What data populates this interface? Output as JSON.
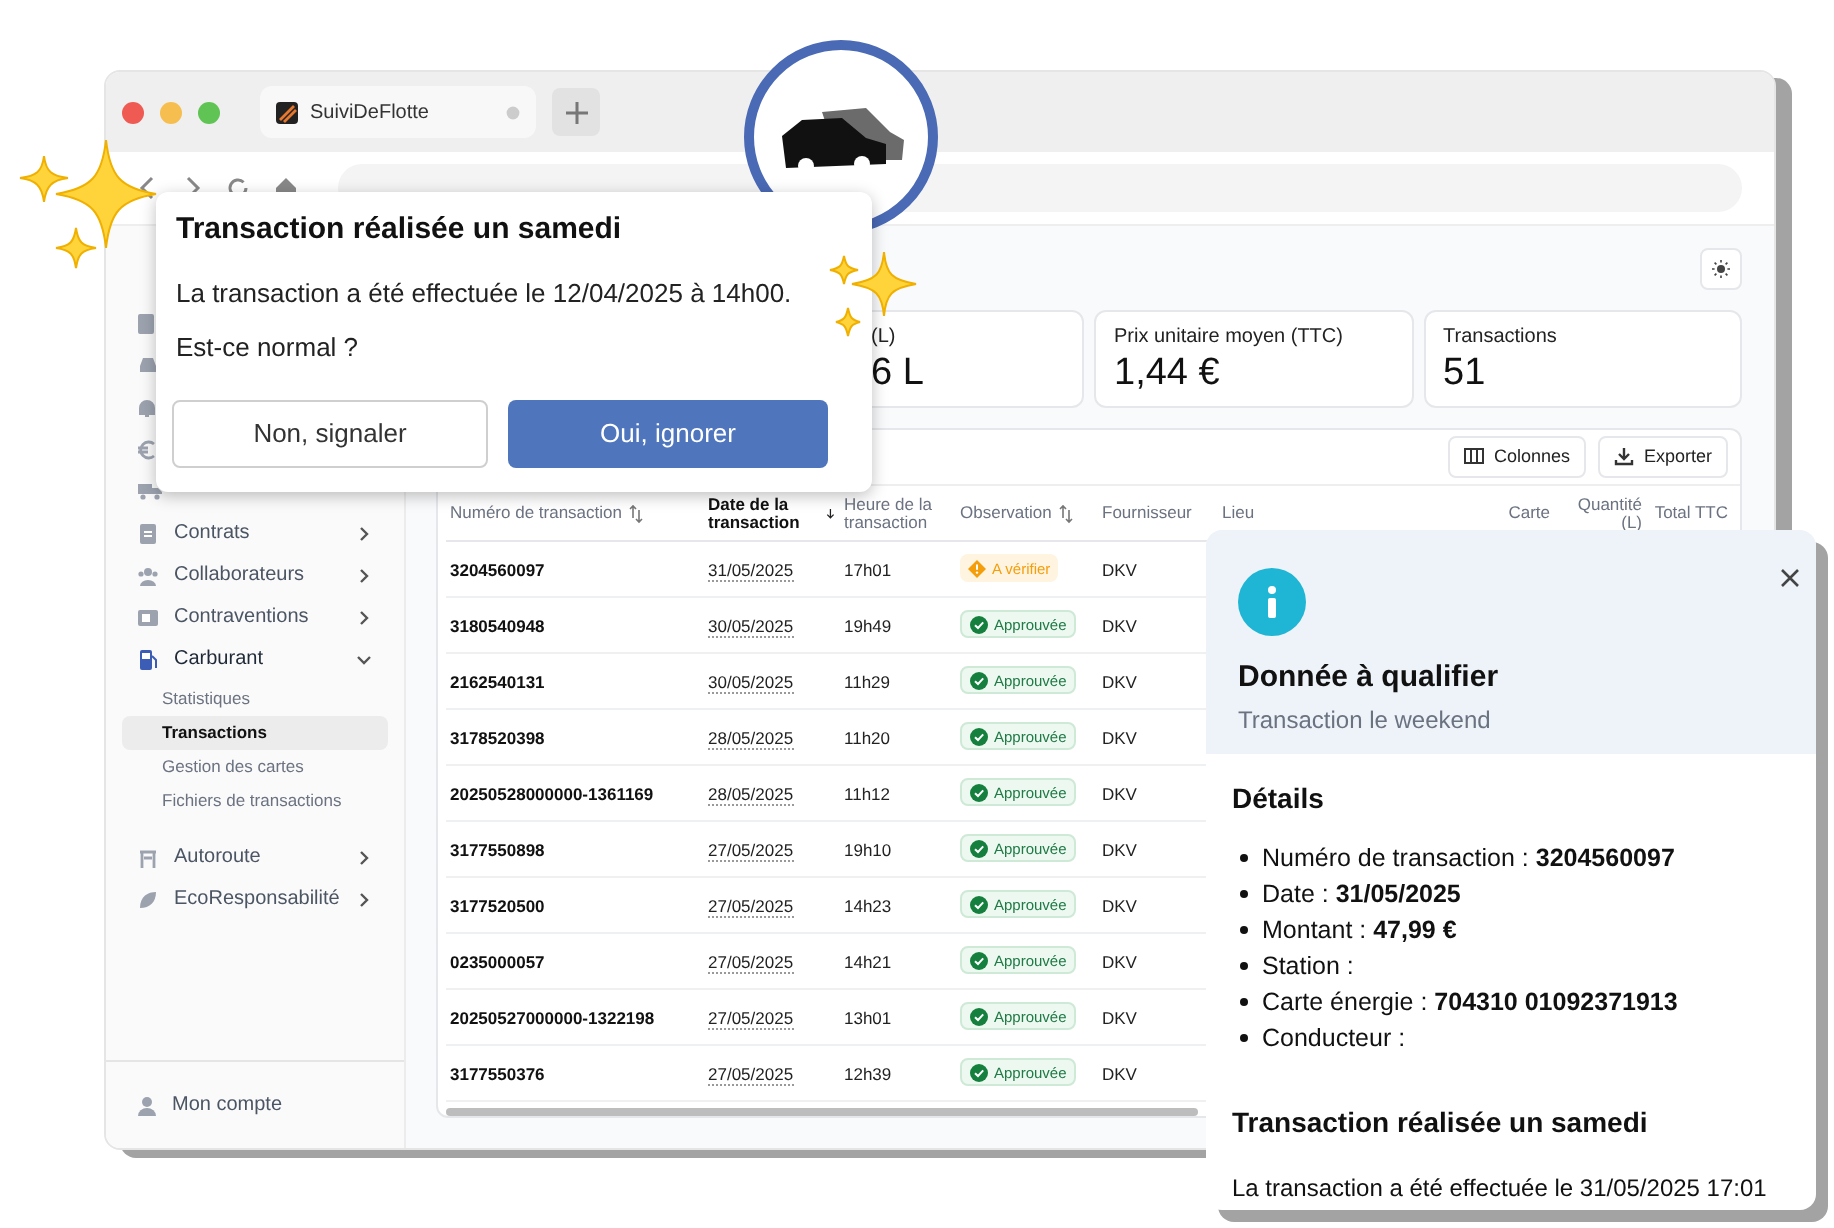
{
  "browser": {
    "tab_title": "SuiviDeFlotte"
  },
  "sidebar": {
    "items": [
      {
        "label": "Contrats",
        "expanded": false
      },
      {
        "label": "Collaborateurs",
        "expanded": false
      },
      {
        "label": "Contraventions",
        "expanded": false
      },
      {
        "label": "Carburant",
        "expanded": true,
        "children": [
          {
            "label": "Statistiques",
            "selected": false
          },
          {
            "label": "Transactions",
            "selected": true
          },
          {
            "label": "Gestion des cartes",
            "selected": false
          },
          {
            "label": "Fichiers de transactions",
            "selected": false
          }
        ]
      },
      {
        "label": "Autoroute",
        "expanded": false
      },
      {
        "label": "EcoResponsabilité",
        "expanded": false
      }
    ],
    "account": "Mon compte"
  },
  "stats": [
    {
      "label": "(L)",
      "value": "6 L"
    },
    {
      "label": "Prix unitaire moyen (TTC)",
      "value": "1,44 €"
    },
    {
      "label": "Transactions",
      "value": "51"
    }
  ],
  "toolbar": {
    "buttons": [
      "Colonnes",
      "Exporter"
    ]
  },
  "table": {
    "columns": [
      {
        "label": "Numéro de transaction",
        "sortable": true,
        "sorted_descending": false
      },
      {
        "label": "Date de la transaction",
        "sortable": false,
        "sorted_descending": true
      },
      {
        "label": "Heure de la transaction",
        "sortable": false,
        "sorted_descending": false
      },
      {
        "label": "Observation",
        "sortable": true,
        "sorted_descending": false
      },
      {
        "label": "Fournisseur",
        "sortable": false,
        "sorted_descending": false
      },
      {
        "label": "Lieu",
        "sortable": false,
        "sorted_descending": false
      },
      {
        "label": "Carte",
        "sortable": false,
        "sorted_descending": false
      },
      {
        "label": "Quantité (L)",
        "sortable": false,
        "sorted_descending": false
      },
      {
        "label": "Total TTC",
        "sortable": false,
        "sorted_descending": false
      }
    ],
    "rows": [
      {
        "number": "3204560097",
        "date": "31/05/2025",
        "time": "17h01",
        "observation": {
          "kind": "warning",
          "label": "A vérifier"
        },
        "supplier": "DKV"
      },
      {
        "number": "3180540948",
        "date": "30/05/2025",
        "time": "19h49",
        "observation": {
          "kind": "approved",
          "label": "Approuvée"
        },
        "supplier": "DKV"
      },
      {
        "number": "2162540131",
        "date": "30/05/2025",
        "time": "11h29",
        "observation": {
          "kind": "approved",
          "label": "Approuvée"
        },
        "supplier": "DKV"
      },
      {
        "number": "3178520398",
        "date": "28/05/2025",
        "time": "11h20",
        "observation": {
          "kind": "approved",
          "label": "Approuvée"
        },
        "supplier": "DKV"
      },
      {
        "number": "20250528000000-1361169",
        "date": "28/05/2025",
        "time": "11h12",
        "observation": {
          "kind": "approved",
          "label": "Approuvée"
        },
        "supplier": "DKV"
      },
      {
        "number": "3177550898",
        "date": "27/05/2025",
        "time": "19h10",
        "observation": {
          "kind": "approved",
          "label": "Approuvée"
        },
        "supplier": "DKV"
      },
      {
        "number": "3177520500",
        "date": "27/05/2025",
        "time": "14h23",
        "observation": {
          "kind": "approved",
          "label": "Approuvée"
        },
        "supplier": "DKV"
      },
      {
        "number": "0235000057",
        "date": "27/05/2025",
        "time": "14h21",
        "observation": {
          "kind": "approved",
          "label": "Approuvée"
        },
        "supplier": "DKV"
      },
      {
        "number": "20250527000000-1322198",
        "date": "27/05/2025",
        "time": "13h01",
        "observation": {
          "kind": "approved",
          "label": "Approuvée"
        },
        "supplier": "DKV"
      },
      {
        "number": "3177550376",
        "date": "27/05/2025",
        "time": "12h39",
        "observation": {
          "kind": "approved",
          "label": "Approuvée"
        },
        "supplier": "DKV"
      }
    ]
  },
  "dialog": {
    "title": "Transaction réalisée un samedi",
    "message": "La transaction a été effectuée le 12/04/2025 à 14h00.",
    "question": "Est-ce normal ?",
    "buttons": [
      {
        "kind": "secondary",
        "label": "Non, signaler"
      },
      {
        "kind": "primary",
        "label": "Oui, ignorer"
      }
    ]
  },
  "panel": {
    "title": "Donnée à qualifier",
    "subtitle": "Transaction le weekend",
    "details_title": "Détails",
    "details": [
      "Numéro de transaction : **3204560097**",
      "Date : **31/05/2025**",
      "Montant : **47,99 €**",
      "Station :",
      "Carte énergie : **704310 01092371913**",
      "Conducteur :"
    ],
    "reason_title": "Transaction réalisée un samedi",
    "reason_text": "La transaction a été effectuée le 31/05/2025 17:01"
  }
}
